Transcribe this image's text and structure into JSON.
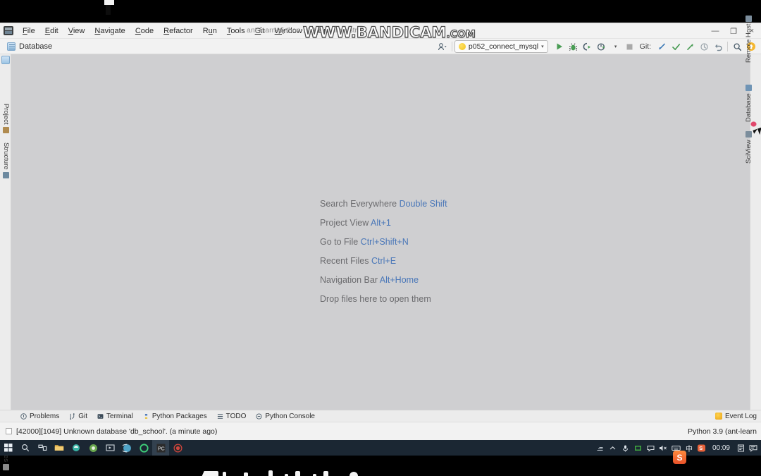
{
  "window": {
    "title": "ant-learn-python-100B - Administr",
    "app_icon": "pycharm-icon",
    "controls": {
      "minimize": "—",
      "restore": "❐",
      "close": "×"
    }
  },
  "watermark": {
    "text_main": "WWW.BANDICAM",
    "text_suffix": ".COM"
  },
  "menubar": {
    "items": [
      {
        "label": "File",
        "mnemonic": "F"
      },
      {
        "label": "Edit",
        "mnemonic": "E"
      },
      {
        "label": "View",
        "mnemonic": "V"
      },
      {
        "label": "Navigate",
        "mnemonic": "N"
      },
      {
        "label": "Code",
        "mnemonic": "C"
      },
      {
        "label": "Refactor",
        "mnemonic": "R"
      },
      {
        "label": "Run",
        "mnemonic": "u"
      },
      {
        "label": "Tools",
        "mnemonic": "T"
      },
      {
        "label": "Git",
        "mnemonic": "G"
      },
      {
        "label": "Window",
        "mnemonic": "W"
      },
      {
        "label": "Help",
        "mnemonic": "H"
      }
    ]
  },
  "toolbar": {
    "active_tab": "Database",
    "run_config": "p052_connect_mysql",
    "run_config_caret": "▾",
    "git_label": "Git:",
    "buttons": [
      {
        "name": "user-avatar-button",
        "glyph": "⚲"
      },
      {
        "name": "run-button",
        "glyph": "▶"
      },
      {
        "name": "debug-button",
        "glyph": "✱"
      },
      {
        "name": "run-coverage-button",
        "glyph": "◑"
      },
      {
        "name": "profile-button",
        "glyph": "◔"
      },
      {
        "name": "stop-button",
        "glyph": "■"
      },
      {
        "name": "git-update-button",
        "glyph": "↙"
      },
      {
        "name": "git-commit-button",
        "glyph": "✓"
      },
      {
        "name": "git-push-button",
        "glyph": "↗"
      },
      {
        "name": "git-history-button",
        "glyph": "◷"
      },
      {
        "name": "git-rollback-button",
        "glyph": "↶"
      },
      {
        "name": "search-button",
        "glyph": "⚲"
      },
      {
        "name": "ide-update-button",
        "glyph": "↑"
      }
    ]
  },
  "left_strip": {
    "items": [
      {
        "label": "Project",
        "icon": "folder-icon"
      },
      {
        "label": "Structure",
        "icon": "structure-icon"
      }
    ],
    "bottom_items": [
      {
        "label": "Favorites",
        "icon": "star-icon"
      }
    ]
  },
  "right_strip": {
    "items": [
      {
        "label": "Remote Host",
        "icon": "remote-host-icon"
      },
      {
        "label": "Database",
        "icon": "database-icon"
      },
      {
        "label": "SciView",
        "icon": "sciview-icon"
      }
    ]
  },
  "editor": {
    "hints": [
      {
        "action": "Search Everywhere",
        "shortcut": "Double Shift"
      },
      {
        "action": "Project View",
        "shortcut": "Alt+1"
      },
      {
        "action": "Go to File",
        "shortcut": "Ctrl+Shift+N"
      },
      {
        "action": "Recent Files",
        "shortcut": "Ctrl+E"
      },
      {
        "action": "Navigation Bar",
        "shortcut": "Alt+Home"
      },
      {
        "action": "Drop files here to open them",
        "shortcut": ""
      }
    ]
  },
  "bottom_tools": {
    "items": [
      {
        "label": "Problems",
        "icon": "problems-icon"
      },
      {
        "label": "Git",
        "icon": "git-icon"
      },
      {
        "label": "Terminal",
        "icon": "terminal-icon"
      },
      {
        "label": "Python Packages",
        "icon": "python-packages-icon"
      },
      {
        "label": "TODO",
        "icon": "todo-icon"
      },
      {
        "label": "Python Console",
        "icon": "python-console-icon"
      }
    ],
    "event_log": "Event Log"
  },
  "statusbar": {
    "message": "[42000][1049] Unknown database 'db_school'. (a minute ago)",
    "interpreter": "Python 3.9 (ant-learn"
  },
  "ime": {
    "logo": "S"
  },
  "taskbar": {
    "left_icons": [
      {
        "name": "start-button",
        "glyph": "⊞",
        "color": "#e8eef4"
      },
      {
        "name": "search-icon",
        "glyph": "⌕",
        "color": "#dfe6ec"
      },
      {
        "name": "task-view-icon",
        "glyph": "⌘",
        "color": "#dfe6ec"
      },
      {
        "name": "file-explorer-icon",
        "glyph": "■",
        "color": "#e8b44a"
      },
      {
        "name": "app-icon-teal",
        "glyph": "●",
        "color": "#39b3a5"
      },
      {
        "name": "chrome-icon",
        "glyph": "●",
        "color": "#6aa84f"
      },
      {
        "name": "media-player-icon",
        "glyph": "▷",
        "color": "#cfd6dc"
      },
      {
        "name": "browser-icon",
        "glyph": "●",
        "color": "#4fa3c7"
      },
      {
        "name": "spotify-icon",
        "glyph": "○",
        "color": "#3fd17a"
      },
      {
        "name": "pycharm-taskbar-icon",
        "glyph": "PC",
        "color": "#e9eef3"
      },
      {
        "name": "recorder-icon",
        "glyph": "◉",
        "color": "#d2453f"
      }
    ],
    "tray_icons": [
      {
        "name": "network-tray-icon",
        "glyph": "⎇"
      },
      {
        "name": "show-hidden-icons",
        "glyph": "∧"
      },
      {
        "name": "headset-tray-icon",
        "glyph": "♂"
      },
      {
        "name": "nvidia-tray-icon",
        "glyph": "■"
      },
      {
        "name": "action-center-icon",
        "glyph": "☐"
      },
      {
        "name": "volume-muted-icon",
        "glyph": "◁×"
      },
      {
        "name": "keyboard-tray-icon",
        "glyph": "⌨"
      },
      {
        "name": "ime-chinese-icon",
        "glyph": "中"
      },
      {
        "name": "sogou-tray-icon",
        "glyph": "S"
      }
    ],
    "clock": "00:09",
    "notification_icons": [
      {
        "name": "notes-tray-icon",
        "glyph": "☰"
      },
      {
        "name": "notification-center-icon",
        "glyph": "▭"
      }
    ]
  }
}
